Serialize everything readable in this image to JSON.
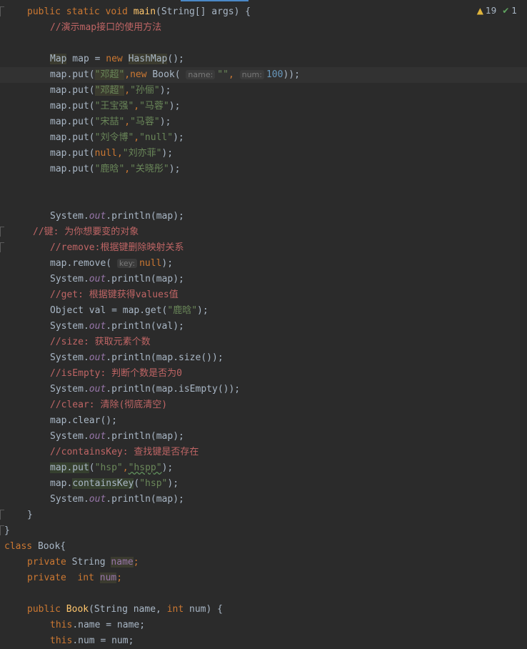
{
  "status": {
    "warnings": "19",
    "ok": "1"
  },
  "lines": [
    {
      "indent": 38,
      "mark": true,
      "tokens": [
        [
          "kw",
          "public static void "
        ],
        [
          "fn",
          "main"
        ],
        [
          "",
          "(String[] args) {"
        ]
      ]
    },
    {
      "indent": 70,
      "tokens": [
        [
          "cmtcn",
          "//演示map接口的使用方法"
        ]
      ]
    },
    {
      "indent": 70,
      "tokens": []
    },
    {
      "indent": 70,
      "tokens": [
        [
          "hl",
          "Map"
        ],
        [
          "",
          " map = "
        ],
        [
          "kw",
          "new "
        ],
        [
          "hl",
          "HashMap"
        ],
        [
          "",
          "();"
        ]
      ]
    },
    {
      "indent": 70,
      "current": true,
      "tokens": [
        [
          "",
          "map.put("
        ],
        [
          "str hl",
          "\"邓超\""
        ],
        [
          "kw",
          ","
        ],
        [
          "kw",
          "new "
        ],
        [
          "",
          "Book( "
        ],
        [
          "hint",
          "name:"
        ],
        [
          "str",
          "\"\""
        ],
        [
          "kw",
          ", "
        ],
        [
          "hint",
          "num:"
        ],
        [
          "num",
          "100"
        ],
        [
          "",
          "));"
        ]
      ]
    },
    {
      "indent": 70,
      "tokens": [
        [
          "",
          "map.put("
        ],
        [
          "str hl",
          "\"邓超\""
        ],
        [
          "kw",
          ","
        ],
        [
          "str",
          "\"孙俪\""
        ],
        [
          "",
          "); "
        ]
      ]
    },
    {
      "indent": 70,
      "tokens": [
        [
          "",
          "map.put("
        ],
        [
          "str",
          "\"王宝强\""
        ],
        [
          "kw",
          ","
        ],
        [
          "str",
          "\"马蓉\""
        ],
        [
          "",
          ");"
        ]
      ]
    },
    {
      "indent": 70,
      "tokens": [
        [
          "",
          "map.put("
        ],
        [
          "str",
          "\"宋喆\""
        ],
        [
          "kw",
          ","
        ],
        [
          "str",
          "\"马蓉\""
        ],
        [
          "",
          ");"
        ]
      ]
    },
    {
      "indent": 70,
      "tokens": [
        [
          "",
          "map.put("
        ],
        [
          "str",
          "\"刘令博\""
        ],
        [
          "kw",
          ","
        ],
        [
          "str",
          "\"null\""
        ],
        [
          "",
          ");"
        ]
      ]
    },
    {
      "indent": 70,
      "tokens": [
        [
          "",
          "map.put("
        ],
        [
          "kw",
          "null"
        ],
        [
          "kw",
          ","
        ],
        [
          "str",
          "\"刘亦菲\""
        ],
        [
          "",
          ");"
        ]
      ]
    },
    {
      "indent": 70,
      "tokens": [
        [
          "",
          "map.put("
        ],
        [
          "str",
          "\"鹿晗\""
        ],
        [
          "kw",
          ","
        ],
        [
          "str",
          "\"关晓彤\""
        ],
        [
          "",
          ");"
        ]
      ]
    },
    {
      "indent": 70,
      "tokens": []
    },
    {
      "indent": 70,
      "tokens": []
    },
    {
      "indent": 70,
      "tokens": [
        [
          "",
          "System."
        ],
        [
          "static",
          "out"
        ],
        [
          "",
          ".println(map);"
        ]
      ]
    },
    {
      "indent": 46,
      "mark": true,
      "tokens": [
        [
          "cmtcn",
          "//键: 为你想要变的对象"
        ]
      ]
    },
    {
      "indent": 70,
      "mark": true,
      "tokens": [
        [
          "cmtcn",
          "//remove:根据键删除映射关系"
        ]
      ]
    },
    {
      "indent": 70,
      "tokens": [
        [
          "",
          "map.remove( "
        ],
        [
          "hint",
          "key:"
        ],
        [
          "kw",
          "null"
        ],
        [
          "",
          ");"
        ]
      ]
    },
    {
      "indent": 70,
      "tokens": [
        [
          "",
          "System."
        ],
        [
          "static",
          "out"
        ],
        [
          "",
          ".println(map);"
        ]
      ]
    },
    {
      "indent": 70,
      "tokens": [
        [
          "cmtcn",
          "//get: 根据键获得values值"
        ]
      ]
    },
    {
      "indent": 70,
      "tokens": [
        [
          "",
          "Object val = map.get("
        ],
        [
          "str",
          "\"鹿晗\""
        ],
        [
          "",
          ");"
        ]
      ]
    },
    {
      "indent": 70,
      "tokens": [
        [
          "",
          "System."
        ],
        [
          "static",
          "out"
        ],
        [
          "",
          ".println(val);"
        ]
      ]
    },
    {
      "indent": 70,
      "tokens": [
        [
          "cmtcn",
          "//size: 获取元素个数"
        ]
      ]
    },
    {
      "indent": 70,
      "tokens": [
        [
          "",
          "System."
        ],
        [
          "static",
          "out"
        ],
        [
          "",
          ".println(map.size());"
        ]
      ]
    },
    {
      "indent": 70,
      "tokens": [
        [
          "cmtcn",
          "//isEmpty: 判断个数是否为0"
        ]
      ]
    },
    {
      "indent": 70,
      "tokens": [
        [
          "",
          "System."
        ],
        [
          "static",
          "out"
        ],
        [
          "",
          ".println(map.isEmpty());"
        ]
      ]
    },
    {
      "indent": 70,
      "tokens": [
        [
          "cmtcn",
          "//clear: 清除(彻底清空)"
        ]
      ]
    },
    {
      "indent": 70,
      "tokens": [
        [
          "",
          "map.clear();"
        ]
      ]
    },
    {
      "indent": 70,
      "tokens": [
        [
          "",
          "System."
        ],
        [
          "static",
          "out"
        ],
        [
          "",
          ".println(map);"
        ]
      ]
    },
    {
      "indent": 70,
      "tokens": [
        [
          "cmtcn",
          "//containsKey: 查找键是否存在"
        ]
      ]
    },
    {
      "indent": 70,
      "tokens": [
        [
          "hlb",
          "map.put"
        ],
        [
          "",
          "("
        ],
        [
          "str",
          "\"hsp\""
        ],
        [
          "kw",
          ","
        ],
        [
          "str squig",
          "\"hspp\""
        ],
        [
          "",
          ");"
        ]
      ]
    },
    {
      "indent": 70,
      "tokens": [
        [
          "",
          "map."
        ],
        [
          "hlb",
          "containsKey"
        ],
        [
          "",
          "("
        ],
        [
          "str",
          "\"hsp\""
        ],
        [
          "",
          ");"
        ]
      ]
    },
    {
      "indent": 70,
      "tokens": [
        [
          "",
          "System."
        ],
        [
          "static",
          "out"
        ],
        [
          "",
          ".println(map);"
        ]
      ]
    },
    {
      "indent": 38,
      "mark": true,
      "tokens": [
        [
          "",
          "}"
        ]
      ]
    },
    {
      "indent": 6,
      "mark": true,
      "tokens": [
        [
          "",
          "}"
        ]
      ]
    },
    {
      "indent": 6,
      "tokens": [
        [
          "kw",
          "class "
        ],
        [
          "",
          "Book{"
        ]
      ]
    },
    {
      "indent": 38,
      "tokens": [
        [
          "kw",
          "private "
        ],
        [
          "",
          "String "
        ],
        [
          "field hl",
          "name"
        ],
        [
          "kw",
          ";"
        ]
      ]
    },
    {
      "indent": 38,
      "tokens": [
        [
          "kw",
          "private  int "
        ],
        [
          "field hl",
          "num"
        ],
        [
          "kw",
          ";"
        ]
      ]
    },
    {
      "indent": 38,
      "tokens": []
    },
    {
      "indent": 38,
      "tokens": [
        [
          "kw",
          "public "
        ],
        [
          "fn",
          "Book"
        ],
        [
          "",
          "(String name, "
        ],
        [
          "kw",
          "int "
        ],
        [
          "",
          "num) {"
        ]
      ]
    },
    {
      "indent": 70,
      "tokens": [
        [
          "kw",
          "this"
        ],
        [
          "",
          ".name = name;"
        ]
      ]
    },
    {
      "indent": 70,
      "tokens": [
        [
          "kw",
          "this"
        ],
        [
          "",
          ".num = num;"
        ]
      ]
    }
  ]
}
